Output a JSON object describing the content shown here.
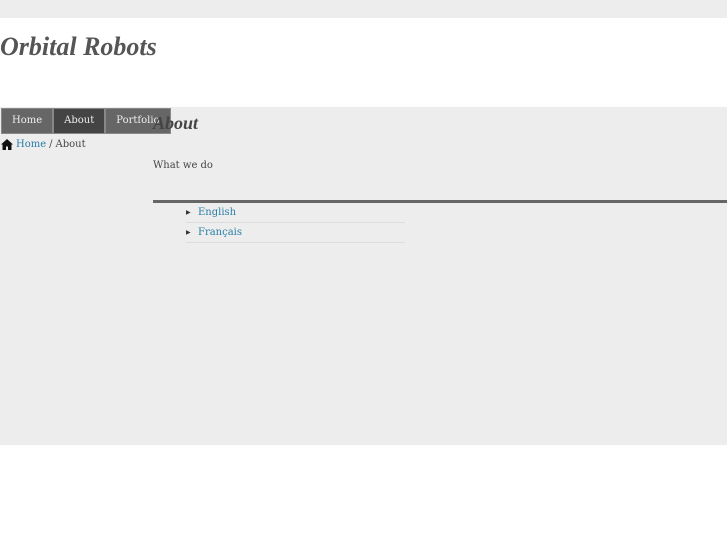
{
  "site_title": "Orbital Robots",
  "nav": [
    "Home",
    "About",
    "Portfolio"
  ],
  "breadcrumb": {
    "home": "Home",
    "sep": "/",
    "current": "About"
  },
  "page": {
    "heading": "About",
    "subtitle": "What we do"
  },
  "languages": [
    "English",
    "Français"
  ]
}
